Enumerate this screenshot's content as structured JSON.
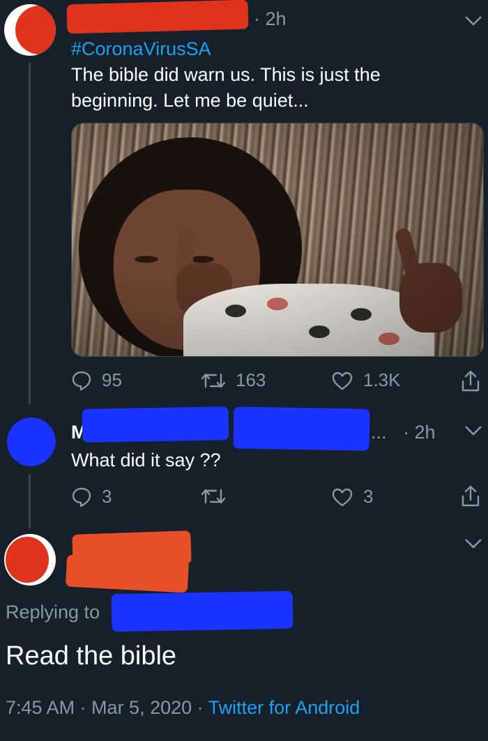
{
  "tweet1": {
    "time": "2h",
    "hashtag": "#CoronaVirusSA",
    "text_line1": "The bible did warn us. This is just the",
    "text_line2": "beginning. Let me be quiet...",
    "replies": "95",
    "retweets": "163",
    "likes": "1.3K"
  },
  "tweet2": {
    "name_initial": "M",
    "ellipsis": "...",
    "time": "2h",
    "text": "What did it say ??",
    "replies": "3",
    "likes": "3"
  },
  "tweet3": {
    "replying_to_label": "Replying to",
    "text": "Read the bible",
    "timestamp": "7:45 AM · Mar 5, 2020 · ",
    "source": "Twitter for Android"
  },
  "colors": {
    "background": "#15202b",
    "secondary_text": "#8899a6",
    "link": "#1da1f2",
    "redaction_red": "#e0331c",
    "redaction_blue": "#1a33ff"
  },
  "icons": [
    "reply-icon",
    "retweet-icon",
    "like-icon",
    "share-icon",
    "chevron-down-icon"
  ]
}
